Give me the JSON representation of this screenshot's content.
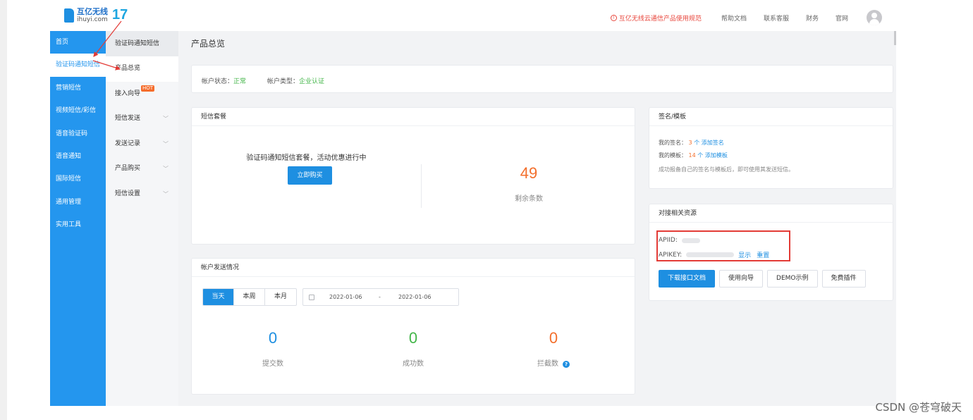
{
  "brand": {
    "name_cn": "互亿无线",
    "name_en": "ihuyi.com",
    "mark": "17"
  },
  "topnav": {
    "notice": "互亿无线云通信产品使用规范",
    "links": [
      "帮助文档",
      "联系客服",
      "财务",
      "官网"
    ]
  },
  "sidebar_primary": {
    "items": [
      "首页",
      "验证码通知短信",
      "营销短信",
      "视频短信/彩信",
      "语音验证码",
      "语音通知",
      "国际短信",
      "通用管理",
      "实用工具"
    ],
    "active_index": 1
  },
  "sidebar_secondary": {
    "title": "验证码通知短信",
    "items": [
      {
        "label": "产品总览",
        "active": true
      },
      {
        "label": "接入向导",
        "badge": "HOT"
      },
      {
        "label": "短信发送"
      },
      {
        "label": "发送记录"
      },
      {
        "label": "产品购买"
      },
      {
        "label": "短信设置"
      }
    ]
  },
  "page": {
    "title": "产品总览"
  },
  "account": {
    "status_label": "帐户状态：",
    "status_value": "正常",
    "type_label": "帐户类型：",
    "type_value": "企业认证"
  },
  "package": {
    "title": "短信套餐",
    "promo": "验证码通知短信套餐，活动优惠进行中",
    "buy_button": "立即购买",
    "remaining": "49",
    "remaining_label": "剩余条数"
  },
  "sending": {
    "title": "帐户发送情况",
    "tabs": [
      "当天",
      "本周",
      "本月"
    ],
    "active_tab": 0,
    "date_from": "2022-01-06",
    "date_sep": "-",
    "date_to": "2022-01-06",
    "stats": [
      {
        "value": "0",
        "label": "提交数",
        "color": "#1e8fe1"
      },
      {
        "value": "0",
        "label": "成功数",
        "color": "#43b649"
      },
      {
        "value": "0",
        "label": "拦截数",
        "color": "#f36f2c"
      }
    ],
    "help": "?"
  },
  "signature": {
    "title": "签名/模板",
    "sign_label": "我的签名：",
    "sign_count": "3",
    "sign_unit": "个",
    "sign_add": "添加签名",
    "tpl_label": "我的模板：",
    "tpl_count": "14",
    "tpl_unit": "个",
    "tpl_add": "添加模板",
    "note": "成功报备自己的签名与模板后，即可使用其发送短信。"
  },
  "resources": {
    "title": "对接相关资源",
    "apiid_label": "APIID:",
    "apikey_label": "APIKEY:",
    "show": "显示",
    "reset": "重置",
    "buttons": [
      "下载接口文档",
      "使用向导",
      "DEMO示例",
      "免费插件"
    ]
  },
  "watermark": "CSDN @苍穹破天",
  "colors": {
    "primary": "#1e8fe1",
    "sidebar": "#2496ee",
    "success": "#43b649",
    "warning": "#f36f2c",
    "annotation": "#e33b36"
  }
}
